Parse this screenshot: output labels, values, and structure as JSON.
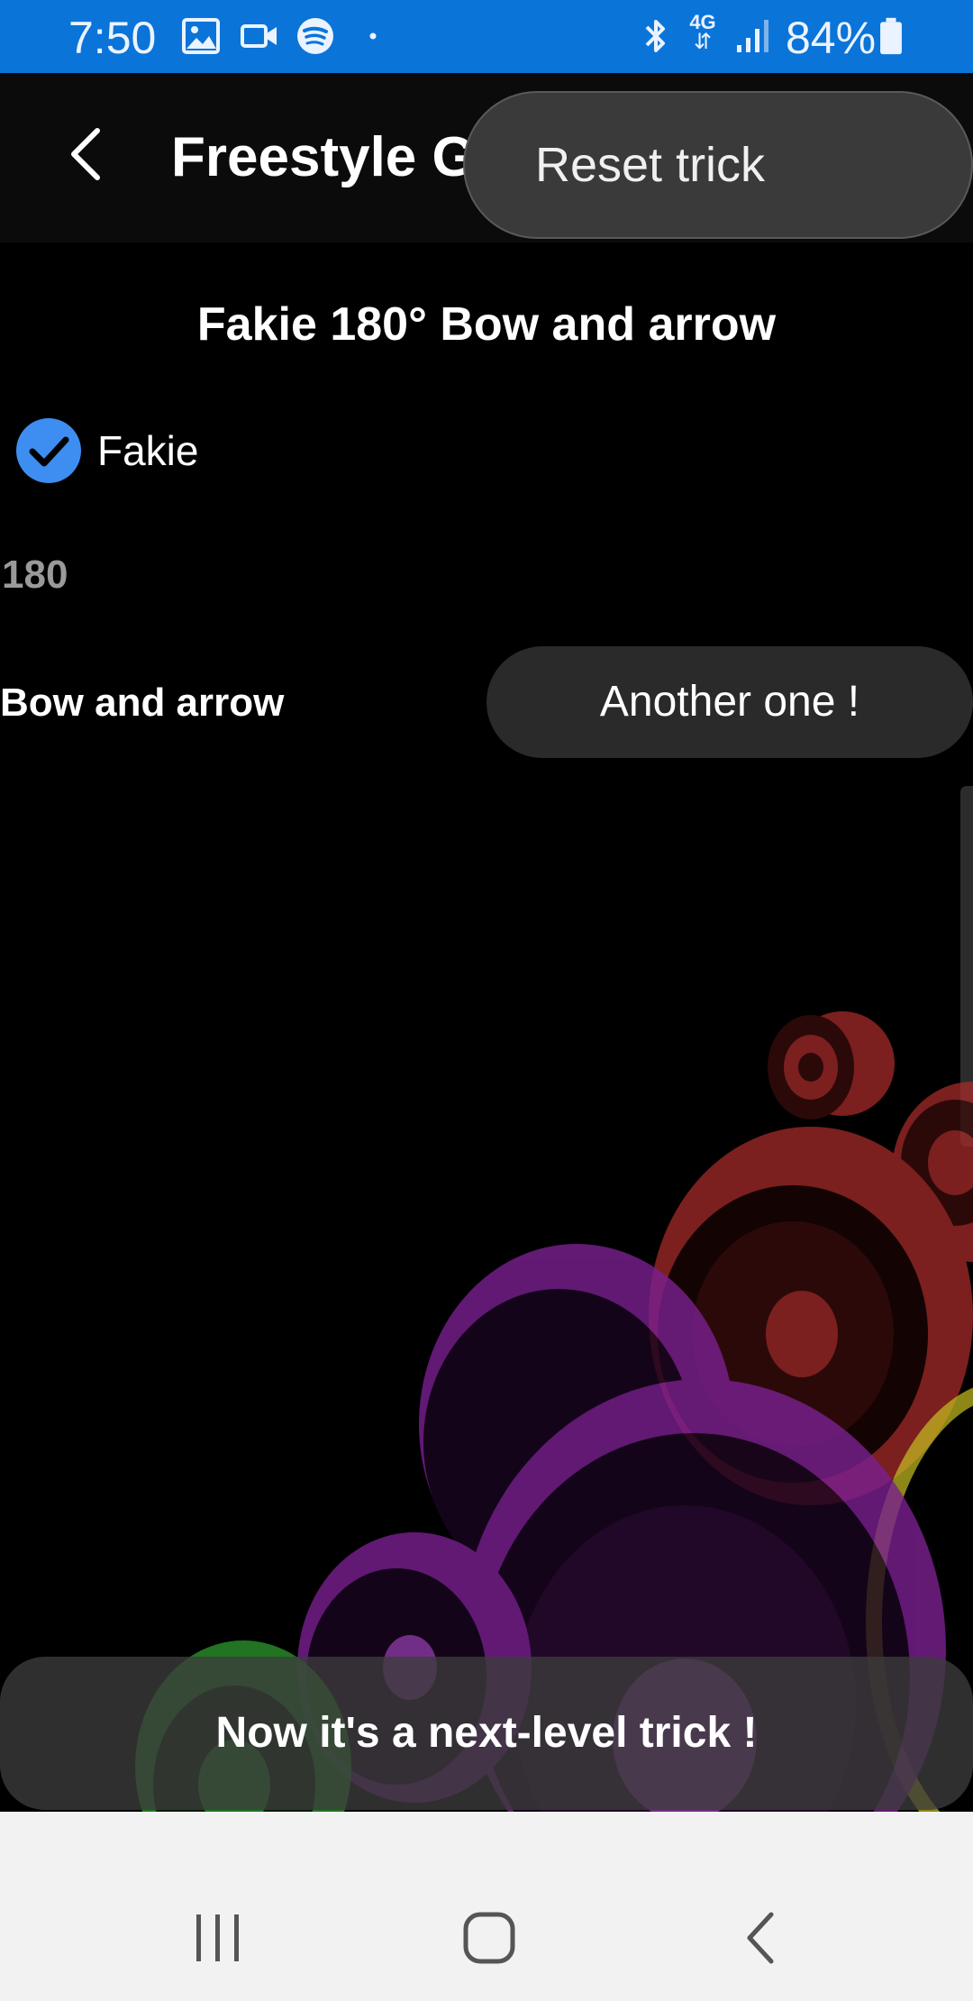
{
  "status_bar": {
    "time": "7:50",
    "battery": "84%",
    "icons": [
      "gallery-icon",
      "video-icon",
      "spotify-icon",
      "dot-icon",
      "bluetooth-icon",
      "4g-icon",
      "signal-icon",
      "battery-icon"
    ],
    "network_label": "4G",
    "bg_color": "#0b74d9"
  },
  "app_bar": {
    "title": "Freestyle Generator",
    "title_visible": "Freestyle Ge"
  },
  "popup_menu": {
    "items": [
      {
        "label": "Reset trick"
      }
    ]
  },
  "content": {
    "trick_title": "Fakie 180° Bow and arrow",
    "fakie_checkbox": {
      "label": "Fakie",
      "checked": true
    },
    "rotation": "180",
    "trick_name": "Bow and arrow",
    "another_button_label": "Another one !"
  },
  "toast": {
    "message": "Now it's a next-level trick !"
  },
  "nav_bar": {
    "buttons": [
      "recent-apps-icon",
      "home-icon",
      "back-icon"
    ]
  },
  "colors": {
    "accent": "#3d8ef0",
    "background": "#000000",
    "button_bg": "#2a2a2a"
  }
}
